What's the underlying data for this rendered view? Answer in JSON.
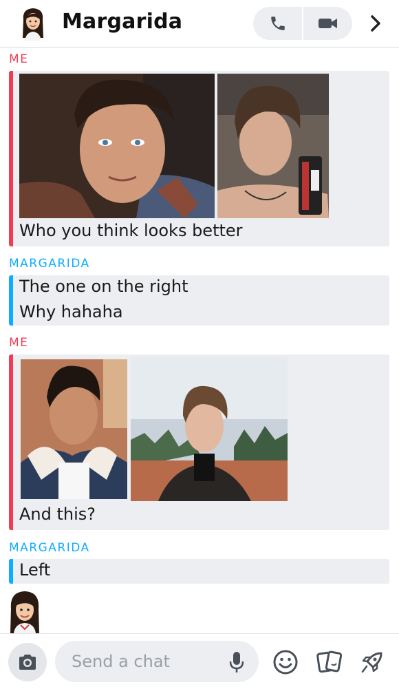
{
  "header": {
    "title": "Margarida",
    "call_icon": "phone-icon",
    "video_icon": "video-camera-icon",
    "chevron_icon": "chevron-right-icon"
  },
  "messages": [
    {
      "sender": "ME",
      "type": "images+text",
      "text": "Who you think looks better",
      "images": [
        "photo of young man with slicked dark hair",
        "mirror selfie of young man with curly hair"
      ]
    },
    {
      "sender": "MARGARIDA",
      "type": "text",
      "lines": [
        "The one on the right",
        "Why hahaha"
      ]
    },
    {
      "sender": "ME",
      "type": "images+text",
      "text": "And this?",
      "images": [
        "photo of man in denim jacket with sherpa collar",
        "photo of man with curly hair in black turtleneck"
      ]
    },
    {
      "sender": "MARGARIDA",
      "type": "text",
      "lines": [
        "Left"
      ]
    }
  ],
  "composer": {
    "placeholder": "Send a chat",
    "icons": [
      "camera-icon",
      "microphone-icon",
      "smiley-icon",
      "stickers-icon",
      "rocket-icon"
    ]
  },
  "colors": {
    "me": "#f23c57",
    "friend": "#0eadff",
    "bubble_bg": "#eceef1"
  }
}
